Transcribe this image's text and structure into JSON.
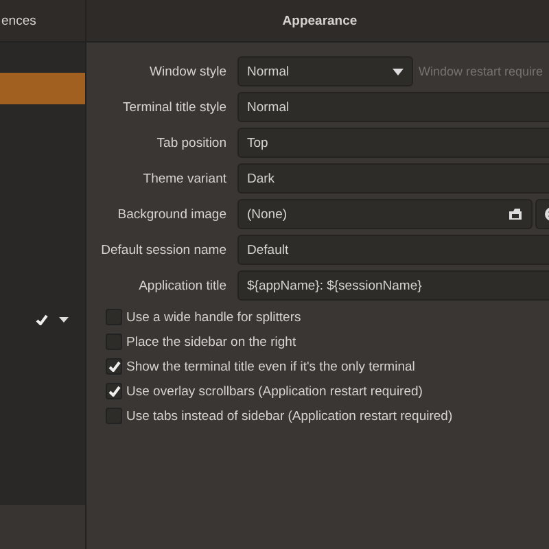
{
  "sidebar": {
    "title": "ences",
    "items": [
      {
        "selected": true
      }
    ]
  },
  "panel": {
    "title": "Appearance",
    "settings": [
      {
        "kind": "dropdown",
        "label": "Window style",
        "value": "Normal",
        "hint": "Window restart require"
      },
      {
        "kind": "entry",
        "label": "Terminal title style",
        "value": "Normal"
      },
      {
        "kind": "entry",
        "label": "Tab position",
        "value": "Top"
      },
      {
        "kind": "entry",
        "label": "Theme variant",
        "value": "Dark"
      },
      {
        "kind": "file",
        "label": "Background image",
        "value": "(None)"
      },
      {
        "kind": "entry",
        "label": "Default session name",
        "value": "Default"
      },
      {
        "kind": "entry",
        "label": "Application title",
        "value": "${appName}: ${sessionName}"
      }
    ],
    "options": [
      {
        "label": "Use a wide handle for splitters",
        "checked": false
      },
      {
        "label": "Place the sidebar on the right",
        "checked": false
      },
      {
        "label": "Show the terminal title even if it's the only terminal",
        "checked": true
      },
      {
        "label": "Use overlay scrollbars (Application restart required)",
        "checked": true
      },
      {
        "label": "Use tabs instead of sidebar (Application restart required)",
        "checked": false
      }
    ]
  }
}
